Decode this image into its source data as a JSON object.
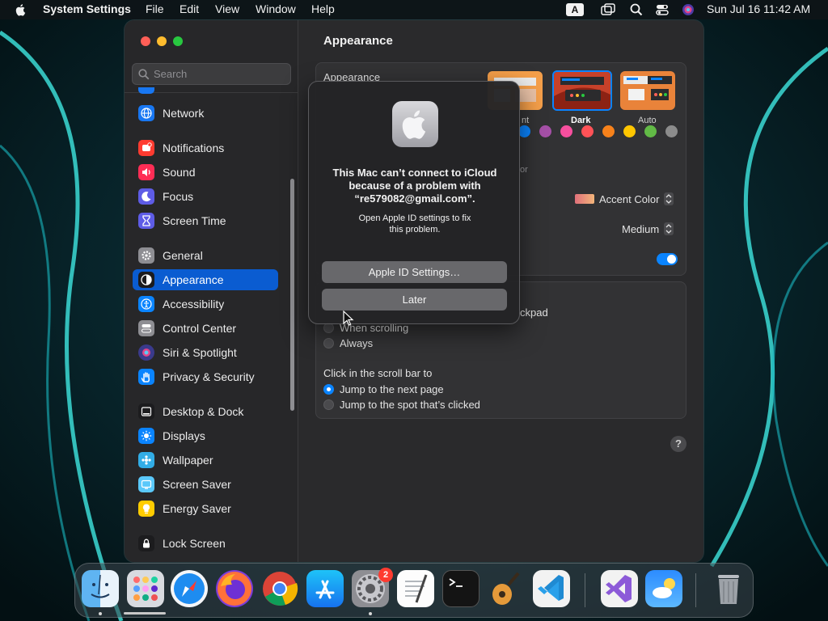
{
  "menubar": {
    "app_name": "System Settings",
    "items": [
      "File",
      "Edit",
      "View",
      "Window",
      "Help"
    ],
    "input_indicator": "A",
    "datetime": "Sun Jul 16  11:42 AM"
  },
  "sidebar": {
    "search_placeholder": "Search",
    "items": [
      {
        "label": "Network",
        "icon": "globe-icon",
        "color": "#1877f2"
      },
      {
        "label": "Notifications",
        "icon": "bell-icon",
        "color": "#ff3b30"
      },
      {
        "label": "Sound",
        "icon": "speaker-icon",
        "color": "#ff2d55"
      },
      {
        "label": "Focus",
        "icon": "moon-icon",
        "color": "#5e5ce6"
      },
      {
        "label": "Screen Time",
        "icon": "hourglass-icon",
        "color": "#5e5ce6"
      },
      {
        "label": "General",
        "icon": "gear-icon",
        "color": "#8e8e93"
      },
      {
        "label": "Appearance",
        "icon": "appearance-icon",
        "color": "#1c1c1e"
      },
      {
        "label": "Accessibility",
        "icon": "accessibility-icon",
        "color": "#0a84ff"
      },
      {
        "label": "Control Center",
        "icon": "control-center-icon",
        "color": "#8e8e93"
      },
      {
        "label": "Siri & Spotlight",
        "icon": "siri-icon",
        "color": "#3a3a8c"
      },
      {
        "label": "Privacy & Security",
        "icon": "hand-icon",
        "color": "#0a84ff"
      },
      {
        "label": "Desktop & Dock",
        "icon": "dock-icon",
        "color": "#1c1c1e"
      },
      {
        "label": "Displays",
        "icon": "sun-icon",
        "color": "#0a84ff"
      },
      {
        "label": "Wallpaper",
        "icon": "wallpaper-icon",
        "color": "#32ade6"
      },
      {
        "label": "Screen Saver",
        "icon": "screen-saver-icon",
        "color": "#5ac8fa"
      },
      {
        "label": "Energy Saver",
        "icon": "bulb-icon",
        "color": "#ffcc00"
      },
      {
        "label": "Lock Screen",
        "icon": "lock-icon",
        "color": "#1c1c1e"
      }
    ],
    "selected": "Appearance"
  },
  "main": {
    "title": "Appearance",
    "appearance_label": "Appearance",
    "modes": [
      "Light",
      "Dark",
      "Auto"
    ],
    "mode_light_visible_fragment": "nt",
    "selected_mode": "Dark",
    "accent_colors": [
      "#0a84ff",
      "#a550a7",
      "#f74f9e",
      "#ff5257",
      "#f7821b",
      "#ffc600",
      "#62ba46",
      "#8c8c8c"
    ],
    "accent_label_fragment": "or",
    "highlight_value": "Accent Color",
    "sidebar_icon_size_value": "Medium",
    "scroll_label_fragment": "ckpad",
    "show_scroll_options": [
      "When scrolling",
      "Always"
    ],
    "click_scroll_label": "Click in the scroll bar to",
    "click_scroll_options": [
      "Jump to the next page",
      "Jump to the spot that’s clicked"
    ],
    "help": "?"
  },
  "alert": {
    "title_lines": [
      "This Mac can’t connect to iCloud",
      "because of a problem with",
      "“re579082@gmail.com”."
    ],
    "message_lines": [
      "Open Apple ID settings to fix",
      "this problem."
    ],
    "primary_button": "Apple ID Settings…",
    "secondary_button": "Later"
  },
  "dock": {
    "apps": [
      "Finder",
      "Launchpad",
      "Safari",
      "Firefox",
      "Chrome",
      "App Store",
      "System Settings",
      "TextEdit",
      "Terminal",
      "GarageBand",
      "Visual Studio Code",
      "Visual Studio",
      "Weather",
      "Trash"
    ],
    "settings_badge": "2"
  }
}
